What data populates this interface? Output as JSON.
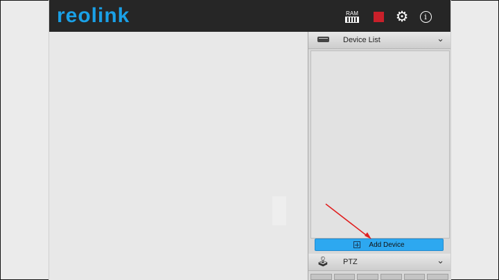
{
  "brand": {
    "logo_text": "reolink",
    "color": "#1aa0e6"
  },
  "toolbar": {
    "ram_label": "RAM",
    "icons": [
      "ram-icon",
      "record-icon",
      "gear-icon",
      "info-icon"
    ],
    "record_color": "#c9202a"
  },
  "device_panel": {
    "title": "Device List",
    "add_button_label": "Add Device",
    "accent": "#2da8f0"
  },
  "ptz_panel": {
    "title": "PTZ"
  },
  "annotation": {
    "arrow_color": "#e02020"
  }
}
